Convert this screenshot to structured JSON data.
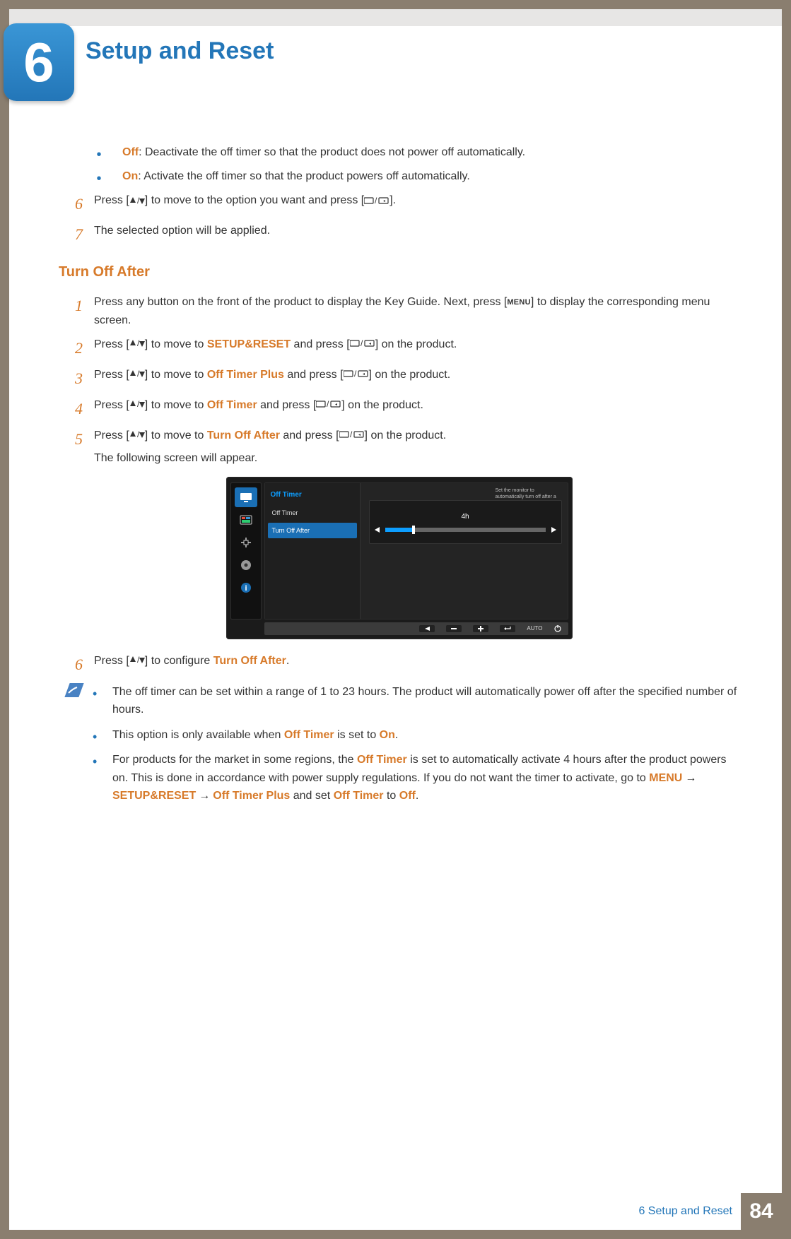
{
  "chapter": {
    "num": "6",
    "title": "Setup and Reset"
  },
  "top_bullets": [
    {
      "label": "Off",
      "text": ": Deactivate the off timer so that the product does not power off automatically."
    },
    {
      "label": "On",
      "text": ": Activate the off timer so that the product powers off automatically."
    }
  ],
  "top_steps": {
    "s6_a": "Press [",
    "s6_b": "] to move to the option you want and press [",
    "s6_c": "].",
    "s7": "The selected option will be applied."
  },
  "section_heading": "Turn Off After",
  "toa_steps": {
    "s1_a": "Press any button on the front of the product to display the Key Guide. Next, press [",
    "s1_menu": "MENU",
    "s1_b": "] to display the corresponding menu screen.",
    "s2_a": "Press [",
    "s2_b": "] to move to ",
    "s2_target": "SETUP&RESET",
    "s2_c": " and press [",
    "s2_d": "] on the product.",
    "s3_target": "Off Timer Plus",
    "s4_target": "Off Timer",
    "s5_target": "Turn Off After",
    "s5_after": "The following screen will appear.",
    "s6_a": "Press [",
    "s6_b": "] to configure ",
    "s6_target": "Turn Off After",
    "s6_c": "."
  },
  "osd": {
    "title": "Off Timer",
    "opt1": "Off Timer",
    "opt2": "Turn Off After",
    "value": "4h",
    "help": "Set the monitor to automatically turn off after a certain time period.",
    "auto": "AUTO"
  },
  "notes": [
    "The off timer can be set within a range of 1 to 23 hours. The product will automatically power off after the specified number of hours.",
    {
      "pre": "This option is only available when ",
      "o1": "Off Timer",
      "mid": " is set to ",
      "o2": "On",
      "post": "."
    },
    {
      "pre": "For products for the market in some regions, the ",
      "o1": "Off Timer",
      "mid": " is set to automatically activate 4 hours after the product powers on. This is done in accordance with power supply regulations. If you do not want the timer to activate, go to ",
      "m1": "MENU",
      "arr": " → ",
      "m2": "SETUP&RESET",
      "m3": "Off Timer Plus",
      "mid2": " and set ",
      "o2": "Off Timer",
      "mid3": " to ",
      "o3": "Off",
      "post": "."
    }
  ],
  "footer": {
    "label": "6 Setup and Reset",
    "page": "84"
  }
}
